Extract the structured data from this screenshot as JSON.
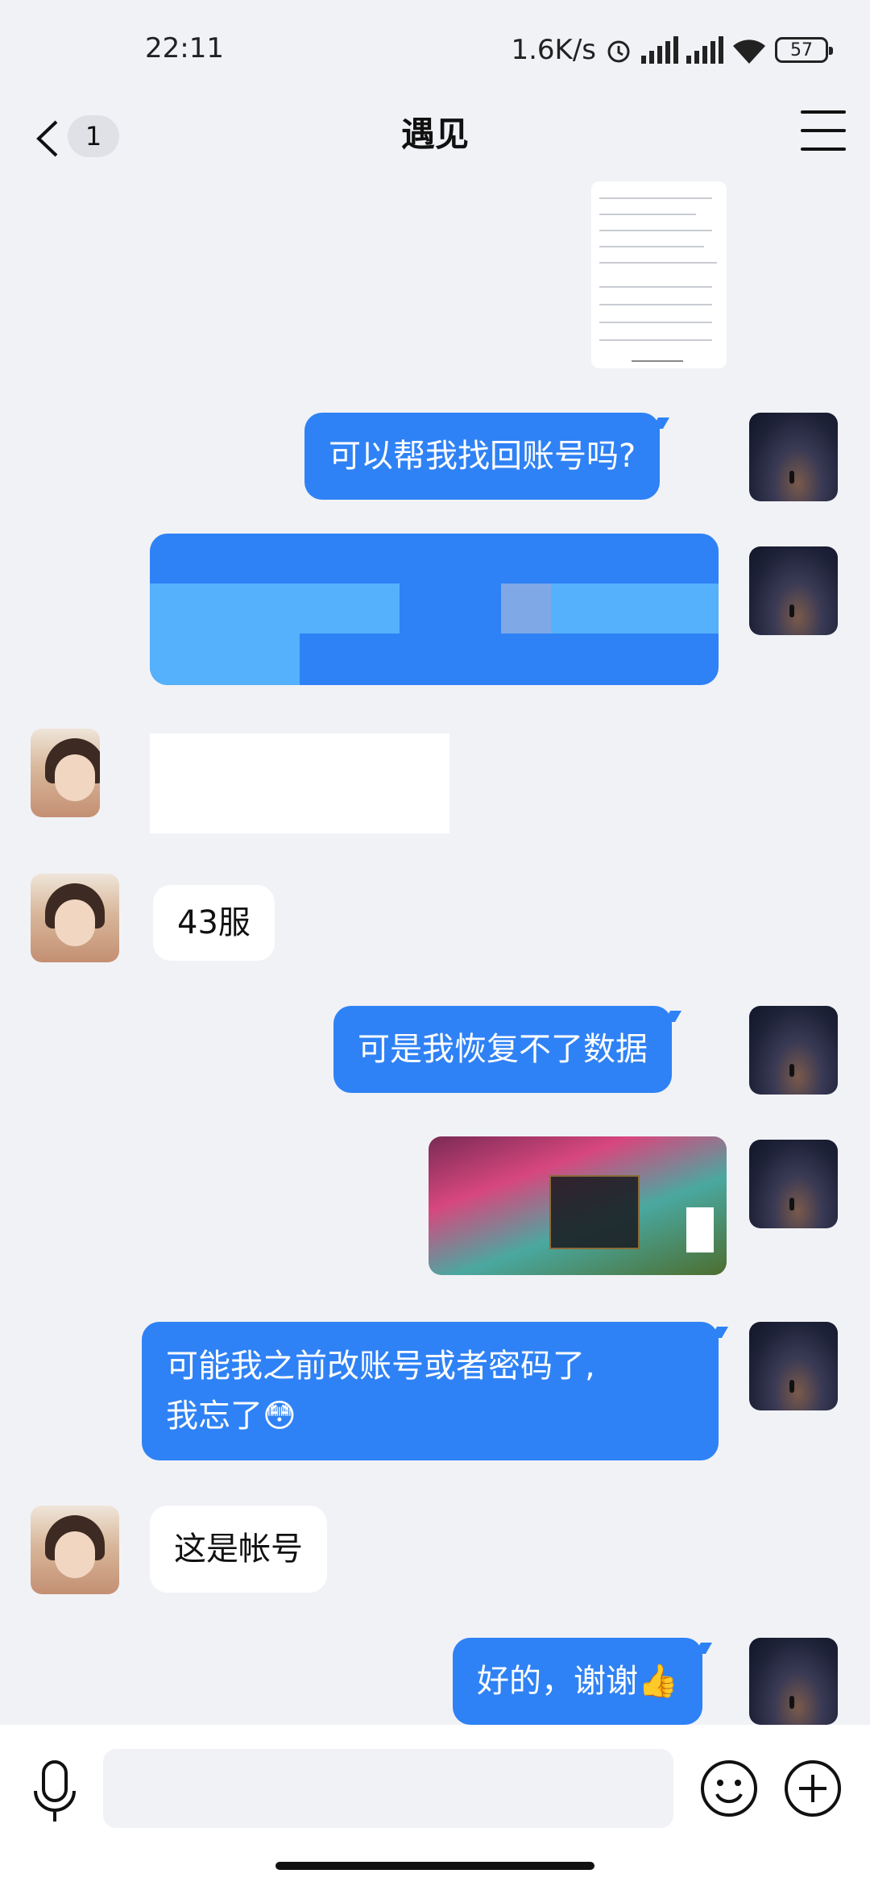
{
  "status": {
    "time": "22:11",
    "network_speed": "1.6K/s",
    "battery": "57",
    "icons": [
      "alarm-icon",
      "hd-signal-icon",
      "signal-icon",
      "wifi-icon",
      "battery-icon"
    ]
  },
  "header": {
    "back_badge": "1",
    "title": "遇见",
    "menu_icon": "menu-icon"
  },
  "messages": {
    "m1": "可以帮我找回账号吗?",
    "m2": "43服",
    "m3": "可是我恢复不了数据",
    "m4_line1": "可能我之前改账号或者密码了,",
    "m4_line2": "我忘了",
    "m4_emoji": "😳",
    "m5": "这是帐号",
    "m6": "好的，谢谢",
    "m6_emoji": "👍"
  },
  "input": {
    "placeholder": ""
  },
  "colors": {
    "my_bubble": "#2f82f5",
    "their_bubble": "#ffffff",
    "background": "#f1f2f6"
  }
}
